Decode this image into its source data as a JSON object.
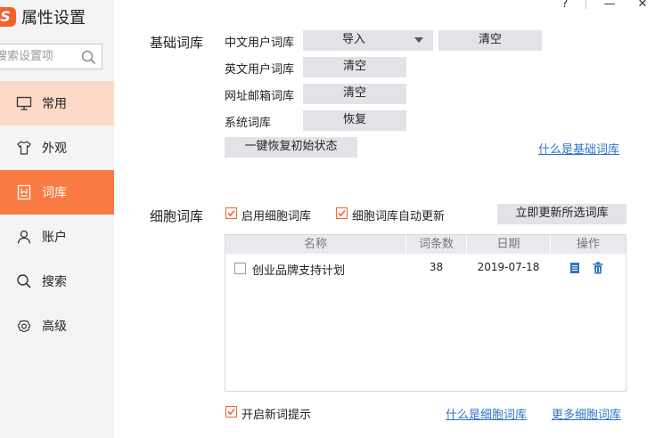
{
  "app": {
    "title": "属性设置"
  },
  "window": {
    "help": "?",
    "minimize": "—",
    "close": "✕"
  },
  "search": {
    "placeholder": "搜索设置项"
  },
  "sidebar": {
    "items": [
      {
        "label": "常用",
        "icon": "monitor-icon",
        "state": "hover"
      },
      {
        "label": "外观",
        "icon": "shirt-icon",
        "state": "normal"
      },
      {
        "label": "词库",
        "icon": "dictionary-icon",
        "state": "active"
      },
      {
        "label": "账户",
        "icon": "user-icon",
        "state": "normal"
      },
      {
        "label": "搜索",
        "icon": "search-icon",
        "state": "normal"
      },
      {
        "label": "高级",
        "icon": "gear-icon",
        "state": "normal"
      }
    ]
  },
  "basic": {
    "title": "基础词库",
    "rows": [
      {
        "label": "中文用户词库",
        "button": "导入",
        "button2": "清空"
      },
      {
        "label": "英文用户词库",
        "button": "清空"
      },
      {
        "label": "网址邮箱词库",
        "button": "清空"
      },
      {
        "label": "系统词库",
        "button": "恢复"
      }
    ],
    "reset_button": "一键恢复初始状态",
    "help_link": "什么是基础词库"
  },
  "cell": {
    "title": "细胞词库",
    "enable_label": "启用细胞词库",
    "auto_update_label": "细胞词库自动更新",
    "update_button": "立即更新所选词库",
    "table": {
      "headers": [
        "名称",
        "词条数",
        "日期",
        "操作"
      ],
      "rows": [
        {
          "name": "创业品牌支持计划",
          "count": "38",
          "date": "2019-07-18",
          "checked": false
        }
      ]
    },
    "new_word_label": "开启新词提示",
    "help_link": "什么是细胞词库",
    "more_link": "更多细胞词库"
  },
  "colors": {
    "accent": "#f97a43",
    "hover": "#fed9c7",
    "link": "#2f74c6",
    "button": "#e1e3e6"
  }
}
